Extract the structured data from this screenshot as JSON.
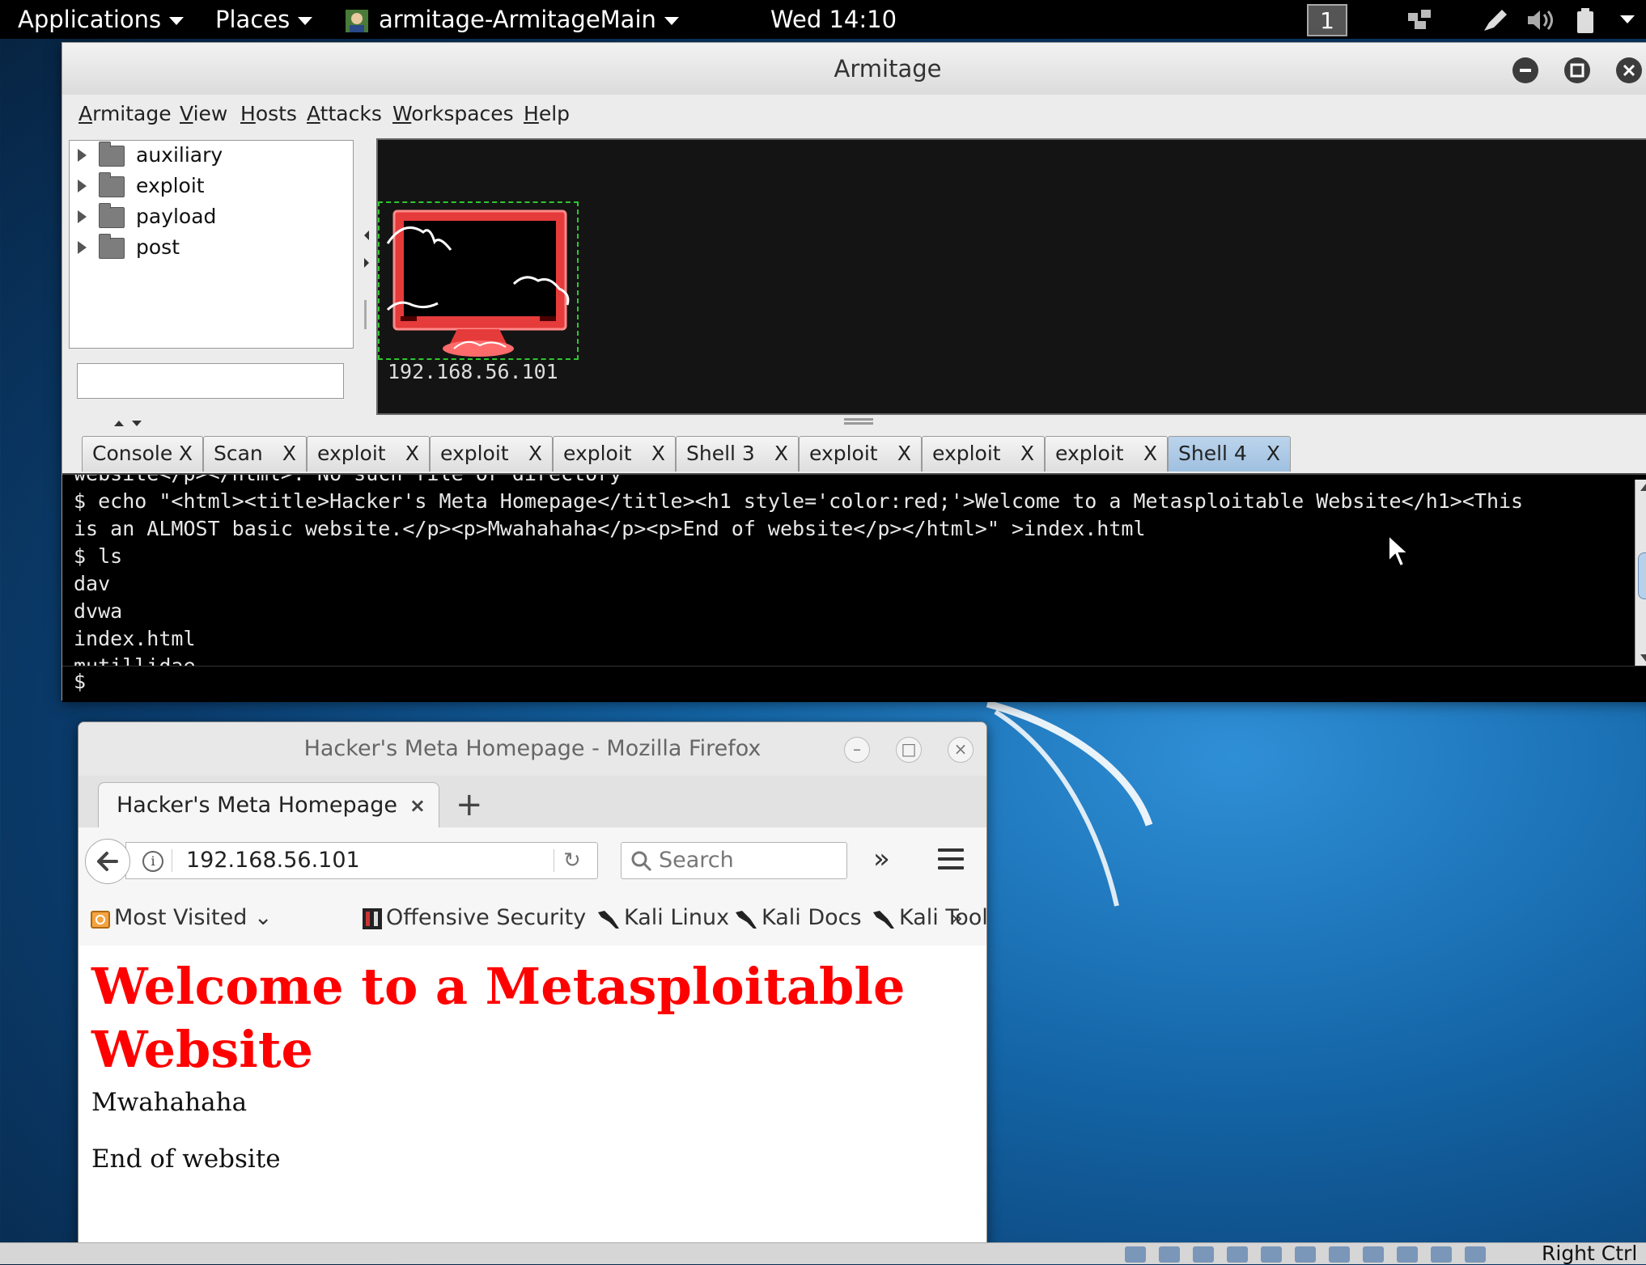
{
  "topbar": {
    "applications": "Applications",
    "places": "Places",
    "active_app": "armitage-ArmitageMain",
    "clock": "Wed 14:10",
    "workspace": "1"
  },
  "armitage": {
    "title": "Armitage",
    "menu": [
      "Armitage",
      "View",
      "Hosts",
      "Attacks",
      "Workspaces",
      "Help"
    ],
    "modules": [
      "auxiliary",
      "exploit",
      "payload",
      "post"
    ],
    "search_value": "",
    "host_ip": "192.168.56.101",
    "tabs": [
      {
        "label": "Console",
        "close": "X"
      },
      {
        "label": "Scan",
        "close": "X"
      },
      {
        "label": "exploit",
        "close": "X"
      },
      {
        "label": "exploit",
        "close": "X"
      },
      {
        "label": "exploit",
        "close": "X"
      },
      {
        "label": "Shell 3",
        "close": "X"
      },
      {
        "label": "exploit",
        "close": "X"
      },
      {
        "label": "exploit",
        "close": "X"
      },
      {
        "label": "exploit",
        "close": "X"
      },
      {
        "label": "Shell 4",
        "close": "X"
      }
    ],
    "active_tab": "Shell 4",
    "console_lines": [
      "website</p></html>: No such file or directory",
      "$ echo \"<html><title>Hacker's Meta Homepage</title><h1 style='color:red;'>Welcome to a Metasploitable Website</h1><This",
      "is an ALMOST basic website.</p><p>Mwahahaha</p><p>End of website</p></html>\" >index.html",
      "$ ls",
      "dav",
      "dvwa",
      "index.html",
      "mutillidae"
    ],
    "prompt": "$"
  },
  "firefox": {
    "window_title": "Hacker's Meta Homepage - Mozilla Firefox",
    "tab_title": "Hacker's Meta Homepage",
    "tab_close": "×",
    "new_tab": "+",
    "url": "192.168.56.101",
    "search_placeholder": "Search",
    "overflow": "»",
    "bookmarks": [
      "Most Visited",
      "Offensive Security",
      "Kali Linux",
      "Kali Docs",
      "Kali Tools"
    ],
    "bookmarks_more": "»",
    "page": {
      "heading": "Welcome to a Metasploitable Website",
      "paragraphs": [
        "Mwahahaha",
        "End of website"
      ]
    }
  },
  "statusbar": {
    "host_key": "Right Ctrl"
  },
  "colors": {
    "page_heading": "#ff0000",
    "host_selection": "#2fc62f",
    "active_tab": "#a8c6e4",
    "desktop_blue": "#1466a8"
  }
}
